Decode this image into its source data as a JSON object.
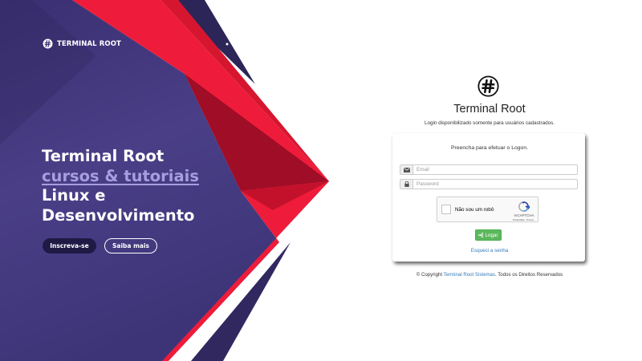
{
  "hero": {
    "brand": "TERMINAL ROOT",
    "headline_line1": "Terminal Root",
    "headline_line2": "cursos & tutoriais",
    "headline_line3": "Linux e",
    "headline_line4": "Desenvolvimento",
    "subscribe_label": "Inscreva-se",
    "learn_more_label": "Saiba mais"
  },
  "login": {
    "title": "Terminal Root",
    "subtitle": "Login disponibilizado somente para usuários cadastrados.",
    "card_title": "Preencha para efetuar o Logon.",
    "email": {
      "placeholder": "Email",
      "value": ""
    },
    "password": {
      "placeholder": "Password",
      "value": ""
    },
    "captcha": {
      "label": "Não sou um robô",
      "brand": "reCAPTCHA",
      "terms": "Privacidade - Termos"
    },
    "submit_label": "Logar",
    "forgot_label": "Esqueci a senha"
  },
  "footer": {
    "prefix": "© Copyright",
    "company_link": "Terminal Root Sistemas",
    "suffix": ". Todos os Direitos Reservados"
  },
  "colors": {
    "hero_purple": "#463d80",
    "accent_red": "#ee1c3a",
    "dark_red": "#a00d27",
    "navy": "#1f1a45",
    "success": "#5cb85c",
    "link": "#337ab7"
  },
  "icons": {
    "logo": "hash-logo-icon",
    "email": "envelope-icon",
    "password": "lock-icon",
    "submit": "sign-in-icon",
    "captcha": "recaptcha-icon"
  }
}
